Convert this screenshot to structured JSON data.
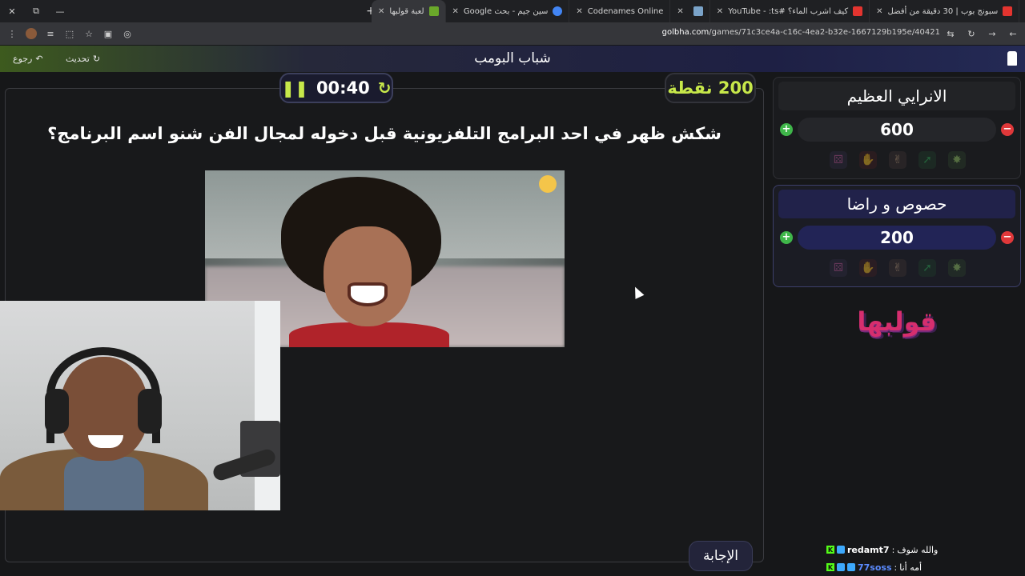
{
  "browser": {
    "tabs": [
      {
        "title": "سبونج بوب | 30 دقيقة من أفضل",
        "favicon_color": "#e3342f",
        "active": false
      },
      {
        "title": "كيف اشرب الماء؟ #YouTube - :ts",
        "favicon_color": "#e3342f",
        "active": false
      },
      {
        "title": "",
        "favicon_color": "#7aa3c9",
        "active": false
      },
      {
        "title": "Codenames Online",
        "favicon_color": "",
        "active": false
      },
      {
        "title": "سين جيم - بحث Google",
        "favicon_color": "#4285f4",
        "active": false
      },
      {
        "title": "لعبة قولبها",
        "favicon_color": "#6aa82a",
        "active": true
      }
    ],
    "url_host": "golbha.com",
    "url_path": "/games/71c3ce4a-c16c-4ea2-b32e-1667129b195e/40421",
    "new_tab": "+",
    "win_minimize": "—",
    "win_restore": "⧉",
    "win_close": "✕"
  },
  "header": {
    "title": "شباب البومب",
    "refresh_label": "تحديث",
    "back_label": "رجوع"
  },
  "game": {
    "points_label": "200 نقطة",
    "timer": "00:40",
    "question": "شكش ظهر في احد البرامج التلفزيونية قبل دخوله لمجال الفن شنو اسم البرنامج؟",
    "answer_label": "الإجابة"
  },
  "teams": [
    {
      "name": "الانرايي العظيم",
      "score": "600"
    },
    {
      "name": "حصوص و راضا",
      "score": "200"
    }
  ],
  "brand": {
    "text": "قولبها",
    "color": "#d62e6e"
  },
  "chat": [
    {
      "user": "redamt7",
      "user_color": "#ffffff",
      "message": "والله شوف"
    },
    {
      "user": "77soss",
      "user_color": "#5b8bff",
      "message": "أمه أنا"
    }
  ],
  "colors": {
    "accent_green": "#c7e84a",
    "plus": "#3fb64a",
    "minus": "#e0383a"
  }
}
